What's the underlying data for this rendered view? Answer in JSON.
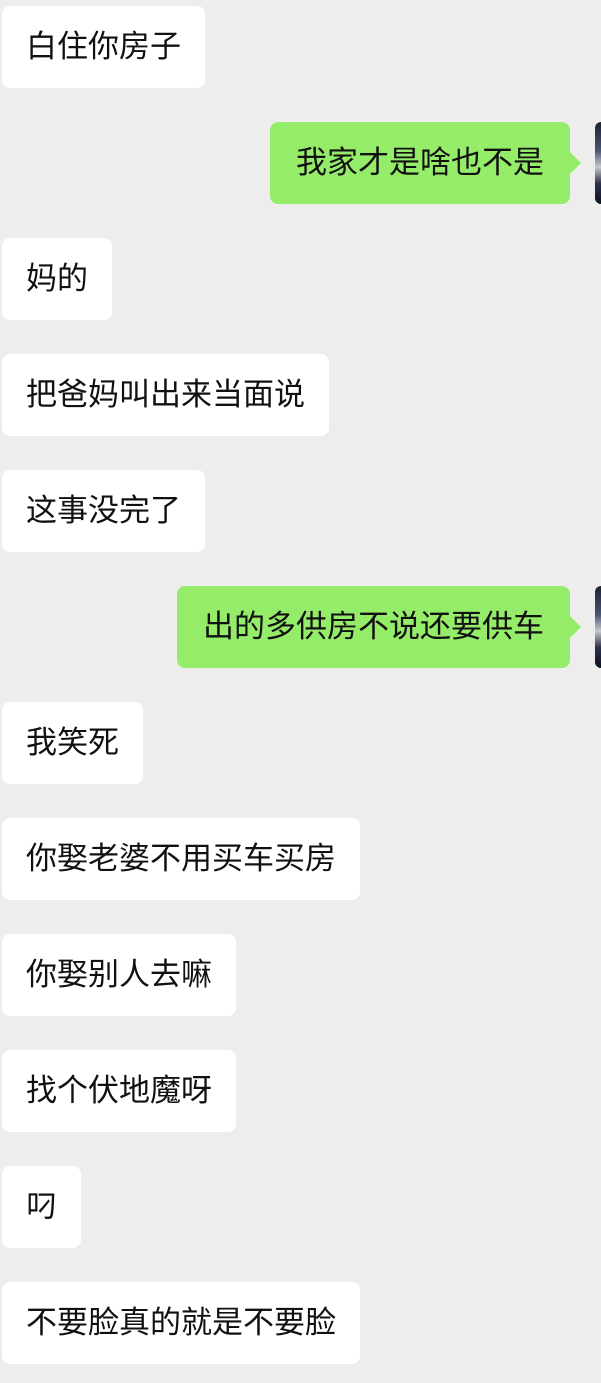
{
  "messages": [
    {
      "side": "in",
      "text": "白住你房子"
    },
    {
      "side": "out",
      "text": "我家才是啥也不是"
    },
    {
      "side": "in",
      "text": "妈的"
    },
    {
      "side": "in",
      "text": "把爸妈叫出来当面说"
    },
    {
      "side": "in",
      "text": "这事没完了"
    },
    {
      "side": "out",
      "text": "出的多供房不说还要供车"
    },
    {
      "side": "in",
      "text": "我笑死"
    },
    {
      "side": "in",
      "text": "你娶老婆不用买车买房"
    },
    {
      "side": "in",
      "text": "你娶别人去嘛"
    },
    {
      "side": "in",
      "text": "找个伏地魔呀"
    },
    {
      "side": "in",
      "text": "叼"
    },
    {
      "side": "in",
      "text": "不要脸真的就是不要脸"
    }
  ],
  "colors": {
    "background": "#ededed",
    "incoming_bubble": "#ffffff",
    "outgoing_bubble": "#95ec69",
    "text": "#111111"
  }
}
